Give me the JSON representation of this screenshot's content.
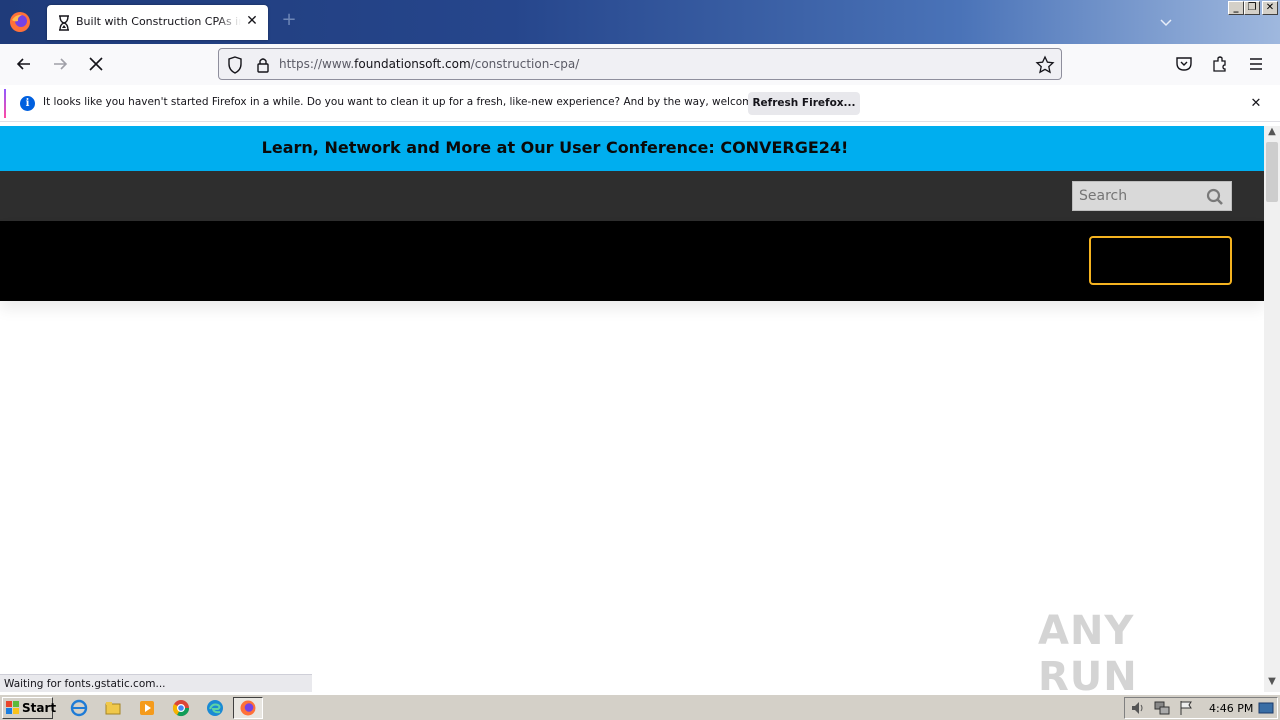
{
  "browser": {
    "tab": {
      "title": "Built with Construction CPAs in Mind",
      "close_glyph": "✕"
    },
    "new_tab_glyph": "+",
    "url": {
      "prefix": "https://www.",
      "domain": "foundationsoft.com",
      "path": "/construction-cpa/"
    },
    "window_buttons": {
      "minimize": "_",
      "restore": "❐",
      "close": "✕"
    }
  },
  "notification": {
    "message": "It looks like you haven't started Firefox in a while. Do you want to clean it up for a fresh, like-new experience? And by the way, welcome back!",
    "button_label": "Refresh Firefox...",
    "close_glyph": "✕",
    "info_glyph": "i"
  },
  "site": {
    "banner_text": "Learn, Network and More at Our User Conference: CONVERGE24!",
    "search_placeholder": "Search",
    "colors": {
      "banner": "#00aeef",
      "topbar": "#2e2e2e",
      "nav": "#000000",
      "cta_border": "#f5b320"
    }
  },
  "status_text": "Waiting for fonts.gstatic.com...",
  "watermark": "ANY RUN",
  "taskbar": {
    "start_label": "Start",
    "clock": "4:46 PM",
    "pinned": [
      "ie-icon",
      "explorer-icon",
      "media-player-icon",
      "chrome-icon",
      "edge-icon",
      "firefox-icon"
    ]
  },
  "scrollbar": {
    "up_glyph": "▲",
    "down_glyph": "▼"
  }
}
